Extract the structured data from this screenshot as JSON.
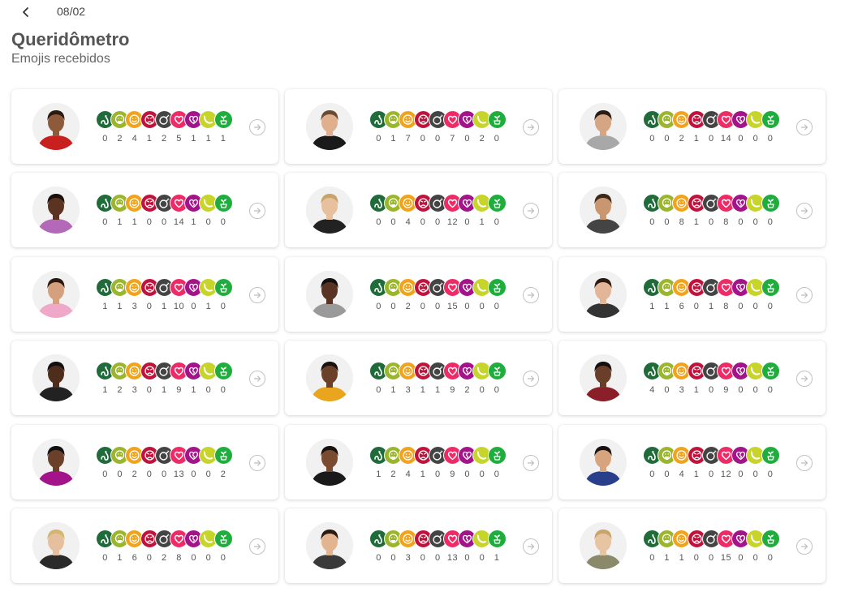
{
  "header": {
    "date": "08/02",
    "title": "Queridômetro",
    "subtitle": "Emojis recebidos"
  },
  "emoji_types": [
    {
      "icon": "snake-icon",
      "color": "#1f6b3a"
    },
    {
      "icon": "vomit-icon",
      "color": "#9bb52c"
    },
    {
      "icon": "smile-icon",
      "color": "#f2a31c"
    },
    {
      "icon": "angry-icon",
      "color": "#c0123b"
    },
    {
      "icon": "bomb-icon",
      "color": "#444444"
    },
    {
      "icon": "heart-icon",
      "color": "#ee2a67"
    },
    {
      "icon": "broken-heart-icon",
      "color": "#a3138a"
    },
    {
      "icon": "banana-icon",
      "color": "#c7d42a"
    },
    {
      "icon": "plant-icon",
      "color": "#1fae3e"
    }
  ],
  "participants": [
    {
      "counts": [
        "0",
        "2",
        "4",
        "1",
        "2",
        "5",
        "1",
        "1",
        "1"
      ],
      "skin": "#8d5a3b",
      "hair": "#2a1a12",
      "shirt": "#c81f1f"
    },
    {
      "counts": [
        "0",
        "1",
        "7",
        "0",
        "0",
        "7",
        "0",
        "2",
        "0"
      ],
      "skin": "#e0b08e",
      "hair": "#6b4a32",
      "shirt": "#1a1a1a"
    },
    {
      "counts": [
        "0",
        "0",
        "2",
        "1",
        "0",
        "14",
        "0",
        "0",
        "0"
      ],
      "skin": "#d6a583",
      "hair": "#2b1d14",
      "shirt": "#a8a8a8"
    },
    {
      "counts": [
        "0",
        "1",
        "1",
        "0",
        "0",
        "14",
        "1",
        "0",
        "0"
      ],
      "skin": "#5a3421",
      "hair": "#1a0f0a",
      "shirt": "#b469b8"
    },
    {
      "counts": [
        "0",
        "0",
        "4",
        "0",
        "0",
        "12",
        "0",
        "1",
        "0"
      ],
      "skin": "#e7c09d",
      "hair": "#c9a36a",
      "shirt": "#222222"
    },
    {
      "counts": [
        "0",
        "0",
        "8",
        "1",
        "0",
        "8",
        "0",
        "0",
        "0"
      ],
      "skin": "#c99670",
      "hair": "#3b2a1a",
      "shirt": "#444444"
    },
    {
      "counts": [
        "1",
        "1",
        "3",
        "0",
        "1",
        "10",
        "0",
        "1",
        "0"
      ],
      "skin": "#d4a07e",
      "hair": "#2a1a12",
      "shirt": "#f0a8c8"
    },
    {
      "counts": [
        "0",
        "0",
        "2",
        "0",
        "0",
        "15",
        "0",
        "0",
        "0"
      ],
      "skin": "#5a3422",
      "hair": "#111111",
      "shirt": "#9a9a9a"
    },
    {
      "counts": [
        "1",
        "1",
        "6",
        "0",
        "1",
        "8",
        "0",
        "0",
        "0"
      ],
      "skin": "#e2b696",
      "hair": "#2b1a10",
      "shirt": "#333333"
    },
    {
      "counts": [
        "1",
        "2",
        "3",
        "0",
        "1",
        "9",
        "1",
        "0",
        "0"
      ],
      "skin": "#4e2d1c",
      "hair": "#141010",
      "shirt": "#222222"
    },
    {
      "counts": [
        "0",
        "1",
        "3",
        "1",
        "1",
        "9",
        "2",
        "0",
        "0"
      ],
      "skin": "#6b4029",
      "hair": "#1a1210",
      "shirt": "#e8a51d"
    },
    {
      "counts": [
        "4",
        "0",
        "3",
        "1",
        "0",
        "9",
        "0",
        "0",
        "0"
      ],
      "skin": "#6a3f29",
      "hair": "#151010",
      "shirt": "#8a1f2a"
    },
    {
      "counts": [
        "0",
        "0",
        "2",
        "0",
        "0",
        "13",
        "0",
        "0",
        "2"
      ],
      "skin": "#6a402b",
      "hair": "#101010",
      "shirt": "#a3138a"
    },
    {
      "counts": [
        "1",
        "2",
        "4",
        "1",
        "0",
        "9",
        "0",
        "0",
        "0"
      ],
      "skin": "#7a4b30",
      "hair": "#1a1210",
      "shirt": "#1a1a1a"
    },
    {
      "counts": [
        "0",
        "0",
        "4",
        "1",
        "0",
        "12",
        "0",
        "0",
        "0"
      ],
      "skin": "#d8a47e",
      "hair": "#1a1210",
      "shirt": "#2a3f8a"
    },
    {
      "counts": [
        "0",
        "1",
        "6",
        "0",
        "2",
        "8",
        "0",
        "0",
        "0"
      ],
      "skin": "#e6c09e",
      "hair": "#d6b56e",
      "shirt": "#2a2a2a"
    },
    {
      "counts": [
        "0",
        "0",
        "3",
        "0",
        "0",
        "13",
        "0",
        "0",
        "1"
      ],
      "skin": "#e2b48f",
      "hair": "#2b1a10",
      "shirt": "#3a3a3a"
    },
    {
      "counts": [
        "0",
        "1",
        "1",
        "0",
        "0",
        "15",
        "0",
        "0",
        "0"
      ],
      "skin": "#e8c5a2",
      "hair": "#c9a56c",
      "shirt": "#8a8a6a"
    }
  ]
}
